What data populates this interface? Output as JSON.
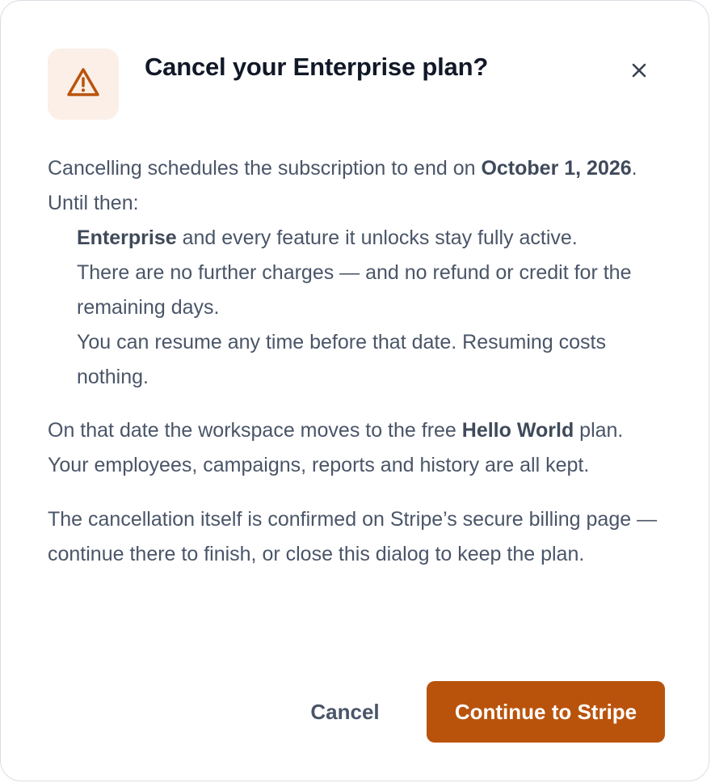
{
  "dialog": {
    "title": "Cancel your Enterprise plan?",
    "icons": {
      "warning": "warning-triangle-icon",
      "close": "close-icon"
    },
    "intro": {
      "text_before": "Cancelling schedules the subscription to end on ",
      "end_date": "October 1, 2026",
      "text_after": ". Until then:"
    },
    "bullets": {
      "b1_bold": "Enterprise",
      "b1_rest": " and every feature it unlocks stay fully active.",
      "b2": "There are no further charges — and no refund or credit for the remaining days.",
      "b3": "You can resume any time before that date. Resuming costs nothing."
    },
    "downgrade": {
      "text_before": "On that date the workspace moves to the free ",
      "plan_name": "Hello World",
      "text_after": " plan. Your employees, campaigns, reports and history are all kept."
    },
    "stripe_note": "The cancellation itself is confirmed on Stripe’s secure billing page — continue there to finish, or close this dialog to keep the plan.",
    "buttons": {
      "cancel": "Cancel",
      "continue": "Continue to Stripe"
    }
  },
  "colors": {
    "accent": "#b9530c",
    "accent_bg": "#fbefe8",
    "title": "#111827",
    "body": "#4a5568"
  }
}
